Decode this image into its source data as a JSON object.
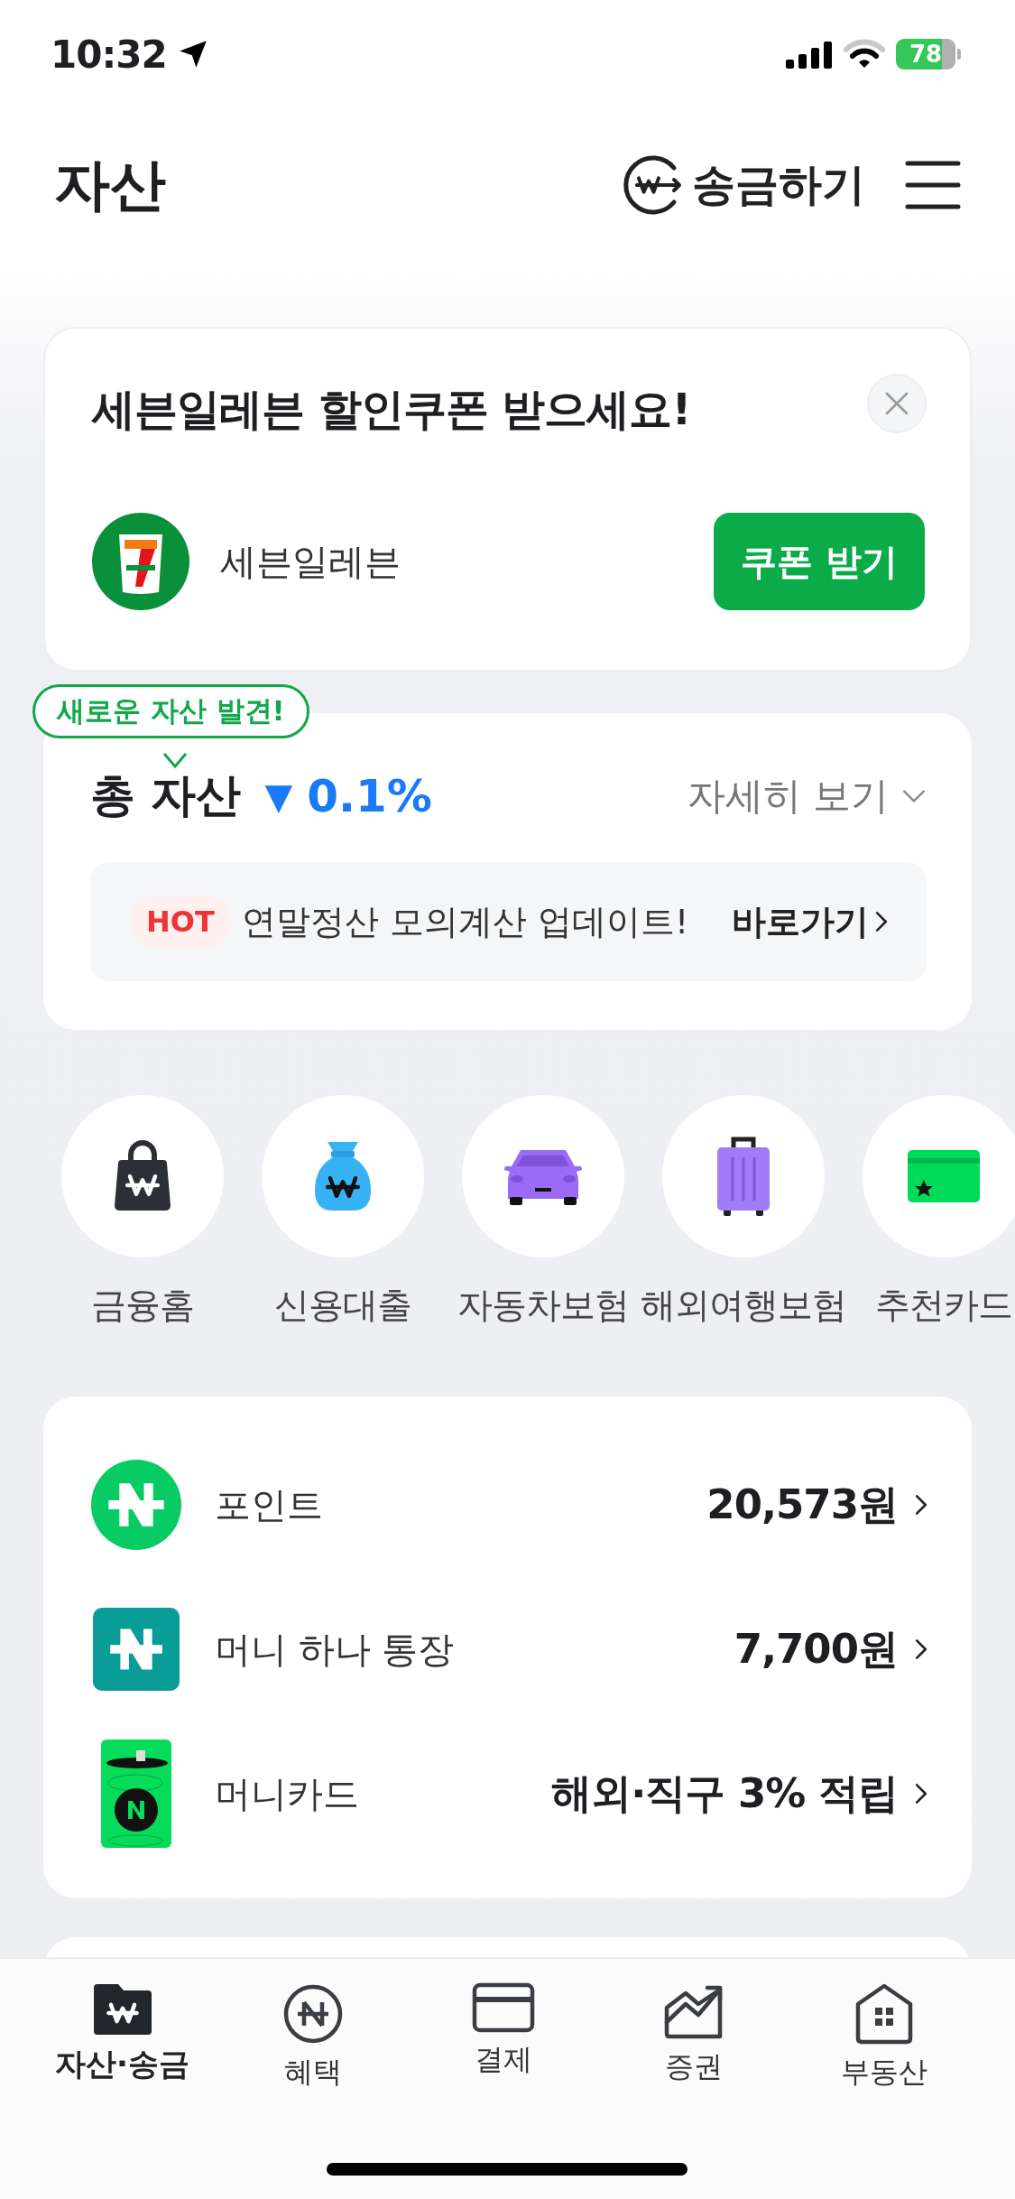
{
  "status_bar": {
    "time": "10:32",
    "battery": "78"
  },
  "header": {
    "title": "자산",
    "transfer_button": "송금하기"
  },
  "coupon_card": {
    "title": "세븐일레븐 할인쿠폰 받으세요!",
    "brand": "세븐일레븐",
    "button": "쿠폰 받기"
  },
  "total_assets": {
    "badge": "새로운 자산 발견!",
    "title": "총 자산",
    "change_marker": "▼",
    "change": "0.1%",
    "details_link": "자세히 보기",
    "notice": {
      "tag": "HOT",
      "text": "연말정산 모의계산 업데이트!",
      "link": "바로가기"
    }
  },
  "shortcuts": [
    {
      "label": "금융홈",
      "kind": "bag"
    },
    {
      "label": "신용대출",
      "kind": "loan"
    },
    {
      "label": "자동차보험",
      "kind": "car"
    },
    {
      "label": "해외여행보험",
      "kind": "travel"
    },
    {
      "label": "추천카드",
      "kind": "card"
    }
  ],
  "accounts": [
    {
      "label": "포인트",
      "value": "20,573원",
      "kind": "point"
    },
    {
      "label": "머니 하나 통장",
      "value": "7,700원",
      "kind": "account"
    },
    {
      "label": "머니카드",
      "value": "해외·직구 3% 적립",
      "kind": "card"
    }
  ],
  "tab_bar": [
    {
      "label": "자산·송금",
      "selected": true
    },
    {
      "label": "혜택",
      "selected": false
    },
    {
      "label": "결제",
      "selected": false
    },
    {
      "label": "증권",
      "selected": false
    },
    {
      "label": "부동산",
      "selected": false
    }
  ]
}
